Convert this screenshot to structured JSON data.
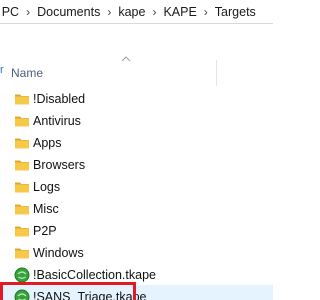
{
  "window": {
    "breadcrumbs": [
      "s PC",
      "Documents",
      "kape",
      "KAPE",
      "Targets"
    ],
    "separator": "›"
  },
  "nav": {
    "partial_glyph": "r"
  },
  "columns": {
    "name_label": "Name"
  },
  "items": [
    {
      "label": "!Disabled",
      "type": "folder"
    },
    {
      "label": "Antivirus",
      "type": "folder"
    },
    {
      "label": "Apps",
      "type": "folder"
    },
    {
      "label": "Browsers",
      "type": "folder"
    },
    {
      "label": "Logs",
      "type": "folder"
    },
    {
      "label": "Misc",
      "type": "folder"
    },
    {
      "label": "P2P",
      "type": "folder"
    },
    {
      "label": "Windows",
      "type": "folder"
    },
    {
      "label": "!BasicCollection.tkape",
      "type": "tkape-file"
    },
    {
      "label": "!SANS_Triage.tkape",
      "type": "tkape-file",
      "selected": true,
      "highlighted": true
    }
  ],
  "colors": {
    "folder": "#f7c948",
    "folder_dark": "#e0a82e",
    "tkape_green": "#38a33b",
    "selection_bg": "#e5f3ff",
    "highlight_red": "#e01b24"
  }
}
